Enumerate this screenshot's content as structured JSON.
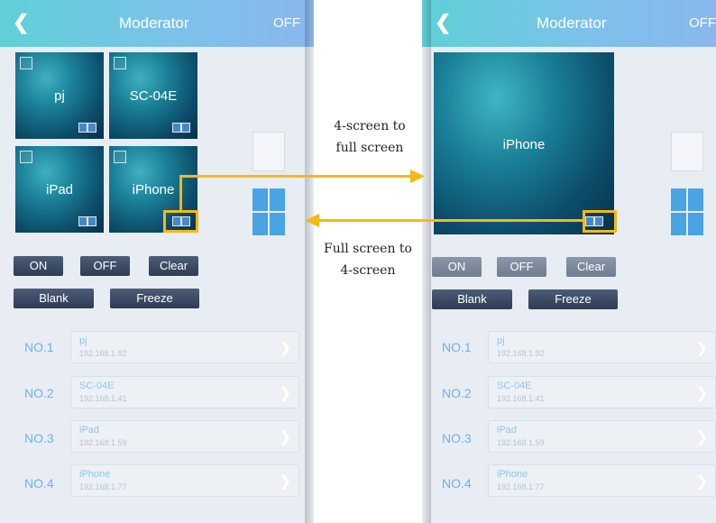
{
  "app": {
    "title": "Moderator",
    "toggle": "OFF"
  },
  "left_phone": {
    "tiles": [
      {
        "label": "pj"
      },
      {
        "label": "SC-04E"
      },
      {
        "label": "iPad"
      },
      {
        "label": "iPhone"
      }
    ]
  },
  "right_phone": {
    "full_tile_label": "iPhone"
  },
  "controls": {
    "on": "ON",
    "off": "OFF",
    "clear": "Clear",
    "blank": "Blank",
    "freeze": "Freeze"
  },
  "devices": [
    {
      "no": "NO.1",
      "name": "pj",
      "ip": "192.168.1.92"
    },
    {
      "no": "NO.2",
      "name": "SC-04E",
      "ip": "192.168.1.41"
    },
    {
      "no": "NO.3",
      "name": "iPad",
      "ip": "192.168.1.59"
    },
    {
      "no": "NO.4",
      "name": "iPhone",
      "ip": "192.168.1.77"
    }
  ],
  "annotations": {
    "to_full": [
      "4-screen to",
      "full screen"
    ],
    "to_quad": [
      "Full screen to",
      "4-screen"
    ]
  },
  "icons": [
    "back-chevron-icon",
    "split-screen-icon",
    "single-layout-icon",
    "quad-layout-icon",
    "chevron-right-icon"
  ],
  "colors": {
    "highlight": "#f5b914",
    "button": "#2e3c53",
    "accent": "#6fb0e8"
  }
}
